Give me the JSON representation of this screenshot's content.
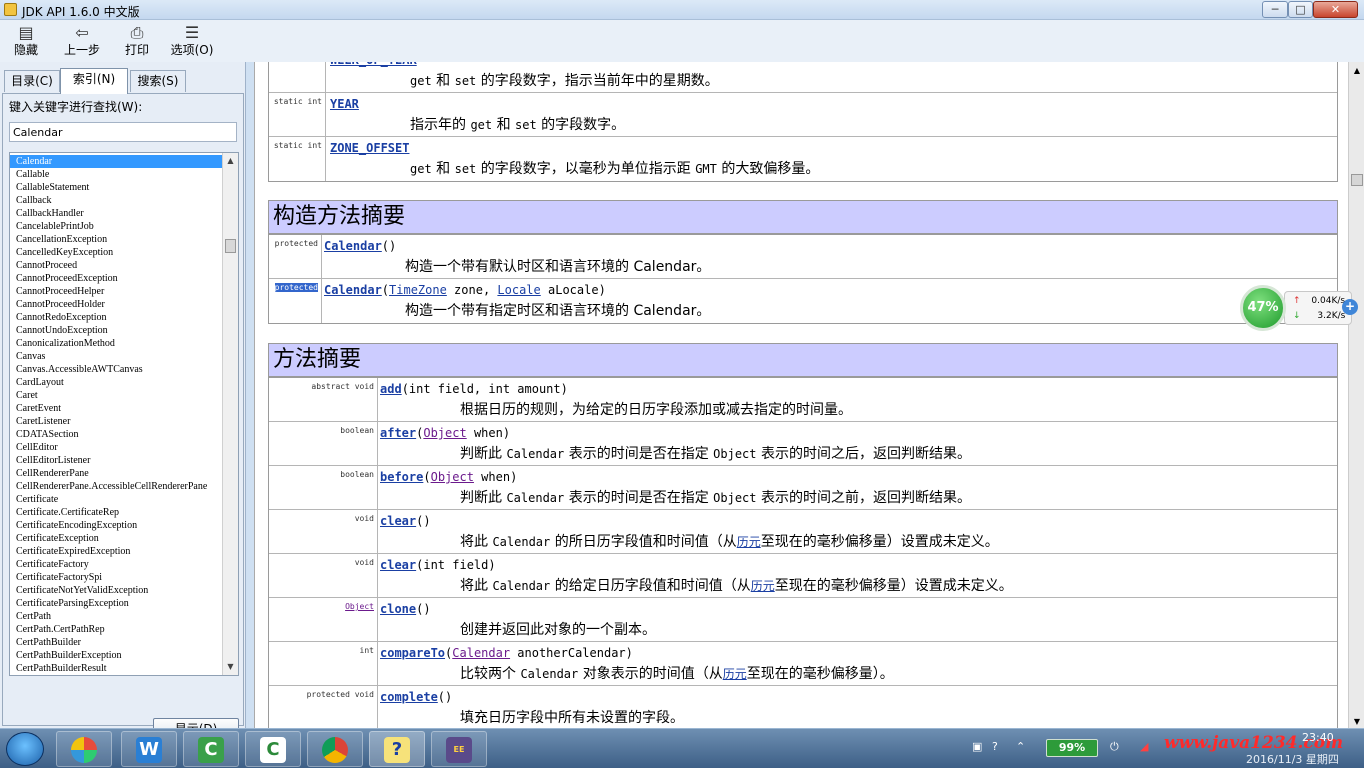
{
  "window": {
    "title": "JDK API 1.6.0 中文版",
    "min_glyph": "─",
    "max_glyph": "□",
    "close_glyph": "✕"
  },
  "toolbar": {
    "hide": {
      "glyph": "▤",
      "label": "隐藏"
    },
    "back": {
      "glyph": "⇦",
      "label": "上一步"
    },
    "print": {
      "glyph": "⎙",
      "label": "打印"
    },
    "options": {
      "glyph": "☰",
      "label": "选项(O)"
    }
  },
  "left_tabs": {
    "contents": "目录(C)",
    "index": "索引(N)",
    "search": "搜索(S)"
  },
  "index_panel": {
    "keyword_label": "键入关键字进行查找(W):",
    "keyword_value": "Calendar",
    "display_button": "显示(D)",
    "items": [
      "Calendar",
      "Callable",
      "CallableStatement",
      "Callback",
      "CallbackHandler",
      "CancelablePrintJob",
      "CancellationException",
      "CancelledKeyException",
      "CannotProceed",
      "CannotProceedException",
      "CannotProceedHelper",
      "CannotProceedHolder",
      "CannotRedoException",
      "CannotUndoException",
      "CanonicalizationMethod",
      "Canvas",
      "Canvas.AccessibleAWTCanvas",
      "CardLayout",
      "Caret",
      "CaretEvent",
      "CaretListener",
      "CDATASection",
      "CellEditor",
      "CellEditorListener",
      "CellRendererPane",
      "CellRendererPane.AccessibleCellRendererPane",
      "Certificate",
      "Certificate.CertificateRep",
      "CertificateEncodingException",
      "CertificateException",
      "CertificateExpiredException",
      "CertificateFactory",
      "CertificateFactorySpi",
      "CertificateNotYetValidException",
      "CertificateParsingException",
      "CertPath",
      "CertPath.CertPathRep",
      "CertPathBuilder",
      "CertPathBuilderException",
      "CertPathBuilderResult"
    ],
    "selected_index": 0
  },
  "fields": [
    {
      "mod": "",
      "name": "WEEK_OF_YEAR",
      "desc_pre": "",
      "desc": [
        {
          "t": "get",
          "mono": true
        },
        {
          "t": " 和 "
        },
        {
          "t": "set",
          "mono": true
        },
        {
          "t": " 的字段数字，指示当前年中的星期数。"
        }
      ]
    },
    {
      "mod": "static int",
      "name": "YEAR",
      "desc": [
        {
          "t": "指示年的 "
        },
        {
          "t": "get",
          "mono": true
        },
        {
          "t": " 和 "
        },
        {
          "t": "set",
          "mono": true
        },
        {
          "t": " 的字段数字。"
        }
      ]
    },
    {
      "mod": "static int",
      "name": "ZONE_OFFSET",
      "desc": [
        {
          "t": "get",
          "mono": true
        },
        {
          "t": " 和 "
        },
        {
          "t": "set",
          "mono": true
        },
        {
          "t": " 的字段数字，以毫秒为单位指示距 "
        },
        {
          "t": "GMT",
          "mono": true
        },
        {
          "t": " 的大致偏移量。"
        }
      ]
    }
  ],
  "constructor_section": {
    "title": "构造方法摘要",
    "rows": [
      {
        "mod": "protected",
        "name": "Calendar",
        "params": [
          {
            "t": "()"
          }
        ],
        "desc": [
          {
            "t": "构造一个带有默认时区和语言环境的 Calendar。"
          }
        ]
      },
      {
        "mod": "protected",
        "mod_selected": true,
        "name": "Calendar",
        "params": [
          {
            "t": "("
          },
          {
            "t": "TimeZone",
            "link": true
          },
          {
            "t": " zone, "
          },
          {
            "t": "Locale",
            "link": true
          },
          {
            "t": " aLocale)"
          }
        ],
        "desc": [
          {
            "t": "构造一个带有指定时区和语言环境的 Calendar。"
          }
        ]
      }
    ]
  },
  "method_section": {
    "title": "方法摘要",
    "rows": [
      {
        "mod": "abstract  void",
        "name": "add",
        "params": [
          {
            "t": "(int field, int amount)"
          }
        ],
        "desc": [
          {
            "t": "根据日历的规则，为给定的日历字段添加或减去指定的时间量。"
          }
        ]
      },
      {
        "mod": "boolean",
        "name": "after",
        "params": [
          {
            "t": "("
          },
          {
            "t": "Object",
            "visited": true
          },
          {
            "t": " when)"
          }
        ],
        "desc": [
          {
            "t": "判断此 "
          },
          {
            "t": "Calendar",
            "mono": true
          },
          {
            "t": " 表示的时间是否在指定 "
          },
          {
            "t": "Object",
            "mono": true
          },
          {
            "t": " 表示的时间之后，返回判断结果。"
          }
        ]
      },
      {
        "mod": "boolean",
        "name": "before",
        "params": [
          {
            "t": "("
          },
          {
            "t": "Object",
            "visited": true
          },
          {
            "t": " when)"
          }
        ],
        "desc": [
          {
            "t": "判断此 "
          },
          {
            "t": "Calendar",
            "mono": true
          },
          {
            "t": " 表示的时间是否在指定 "
          },
          {
            "t": "Object",
            "mono": true
          },
          {
            "t": " 表示的时间之前，返回判断结果。"
          }
        ]
      },
      {
        "mod": "void",
        "name": "clear",
        "params": [
          {
            "t": "()"
          }
        ],
        "desc": [
          {
            "t": "将此 "
          },
          {
            "t": "Calendar",
            "mono": true
          },
          {
            "t": " 的所日历字段值和时间值（从"
          },
          {
            "t": "历元",
            "link": true
          },
          {
            "t": "至现在的毫秒偏移量）设置成未定义。"
          }
        ]
      },
      {
        "mod": "void",
        "name": "clear",
        "params": [
          {
            "t": "(int field)"
          }
        ],
        "desc": [
          {
            "t": "将此 "
          },
          {
            "t": "Calendar",
            "mono": true
          },
          {
            "t": " 的给定日历字段值和时间值（从"
          },
          {
            "t": "历元",
            "link": true
          },
          {
            "t": "至现在的毫秒偏移量）设置成未定义。"
          }
        ]
      },
      {
        "mod": "Object",
        "mod_link": true,
        "name": "clone",
        "params": [
          {
            "t": "()"
          }
        ],
        "desc": [
          {
            "t": "创建并返回此对象的一个副本。"
          }
        ]
      },
      {
        "mod": "int",
        "name": "compareTo",
        "params": [
          {
            "t": "("
          },
          {
            "t": "Calendar",
            "visited": true
          },
          {
            "t": " anotherCalendar)"
          }
        ],
        "desc": [
          {
            "t": "比较两个 "
          },
          {
            "t": "Calendar",
            "mono": true
          },
          {
            "t": " 对象表示的时间值（从"
          },
          {
            "t": "历元",
            "link": true
          },
          {
            "t": "至现在的毫秒偏移量）。"
          }
        ]
      },
      {
        "mod": "protected  void",
        "name": "complete",
        "params": [
          {
            "t": "()"
          }
        ],
        "desc": [
          {
            "t": "填充日历字段中所有未设置的字段。"
          }
        ]
      }
    ]
  },
  "net_widget": {
    "percent": "47%",
    "up": "0.04K/s",
    "down": "3.2K/s",
    "up_arrow": "↑",
    "down_arrow": "↓",
    "plus": "+"
  },
  "taskbar": {
    "apps": [
      {
        "id": "t1",
        "name": "gallery-app"
      },
      {
        "id": "t2",
        "name": "wps-writer",
        "glyph": "W"
      },
      {
        "id": "t3",
        "name": "camtasia-app-1",
        "glyph": "C"
      },
      {
        "id": "t4",
        "name": "camtasia-app-2",
        "glyph": "C"
      },
      {
        "id": "t5",
        "name": "chrome-browser"
      },
      {
        "id": "t6",
        "name": "help-viewer",
        "glyph": "?"
      },
      {
        "id": "t7",
        "name": "eclipse-app",
        "glyph": "EE"
      }
    ],
    "battery": "99%",
    "watermark": "www.java1234.com",
    "clock_time": "23:40",
    "clock_date": "2016/11/3 星期四"
  },
  "colors": {
    "section_head": "#ccccff",
    "link": "#1a3fa3",
    "visited": "#6b1a8c",
    "selection": "#3399ff"
  }
}
